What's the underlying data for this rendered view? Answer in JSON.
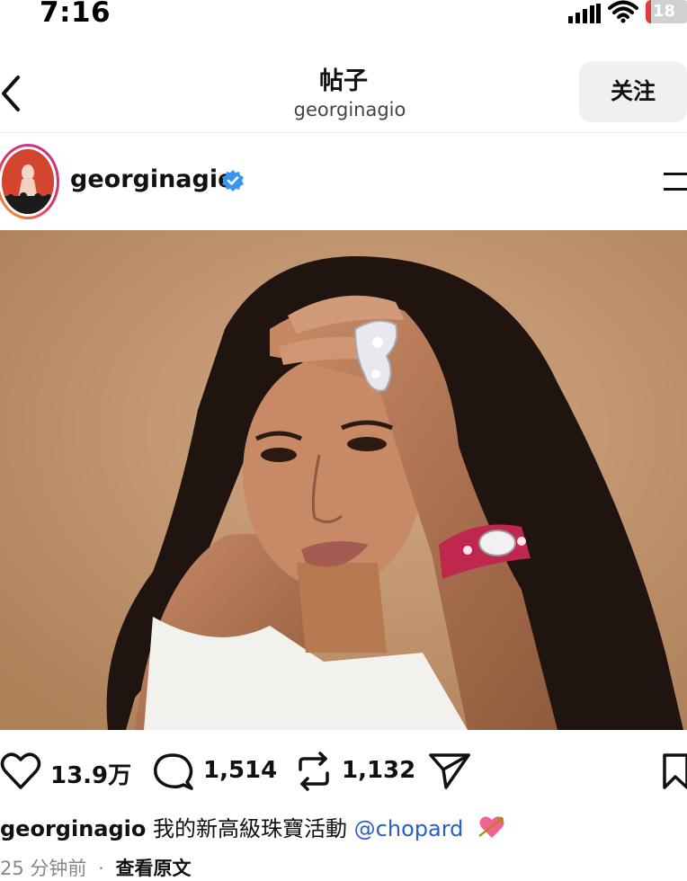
{
  "status_bar": {
    "time": "7:16",
    "battery": "18",
    "icons": [
      "signal-icon",
      "wifi-icon",
      "battery-icon"
    ]
  },
  "nav": {
    "title": "帖子",
    "subtitle": "georginagio",
    "follow_label": "关注",
    "back_icon": "chevron-left-icon"
  },
  "post": {
    "username": "georginagio",
    "verified": true,
    "more_icon": "menu-icon",
    "image_description_icon": "photo"
  },
  "actions": {
    "likes": "13.9万",
    "comments": "1,514",
    "reposts": "1,132"
  },
  "caption": {
    "username": "georginagio",
    "text": "我的新高級珠寶活動",
    "mention": "@chopard",
    "emoji_icon": "heart-arrow-emoji"
  },
  "meta": {
    "time_ago": "25 分钟前",
    "separator": "·",
    "see_original": "查看原文"
  },
  "colors": {
    "accent_link": "#2a5fc7",
    "verified_blue": "#3797f0",
    "follow_button_bg": "#eef0f2",
    "photo_background": "#c49a74"
  }
}
